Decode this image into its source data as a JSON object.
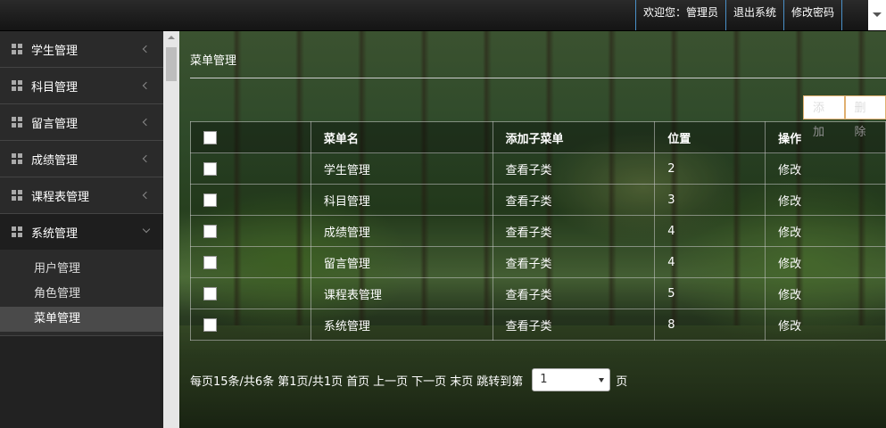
{
  "topbar": {
    "welcome": "欢迎您：管理员",
    "logout": "退出系统",
    "change_password": "修改密码"
  },
  "sidebar": {
    "items": [
      {
        "label": "学生管理",
        "icon": "grid-icon"
      },
      {
        "label": "科目管理",
        "icon": "grid-icon"
      },
      {
        "label": "留言管理",
        "icon": "grid-icon"
      },
      {
        "label": "成绩管理",
        "icon": "grid-icon"
      },
      {
        "label": "课程表管理",
        "icon": "grid-icon"
      },
      {
        "label": "系统管理",
        "icon": "grid-icon"
      }
    ],
    "submenu": [
      {
        "label": "用户管理"
      },
      {
        "label": "角色管理"
      },
      {
        "label": "菜单管理"
      }
    ]
  },
  "main": {
    "title": "菜单管理",
    "add_button": "添加",
    "delete_button": "删除",
    "table": {
      "headers": [
        "",
        "菜单名",
        "添加子菜单",
        "位置",
        "操作"
      ],
      "rows": [
        {
          "name": "学生管理",
          "sub": "查看子类",
          "position": "2",
          "action": "修改"
        },
        {
          "name": "科目管理",
          "sub": "查看子类",
          "position": "3",
          "action": "修改"
        },
        {
          "name": "成绩管理",
          "sub": "查看子类",
          "position": "4",
          "action": "修改"
        },
        {
          "name": "留言管理",
          "sub": "查看子类",
          "position": "4",
          "action": "修改"
        },
        {
          "name": "课程表管理",
          "sub": "查看子类",
          "position": "5",
          "action": "修改"
        },
        {
          "name": "系统管理",
          "sub": "查看子类",
          "position": "8",
          "action": "修改"
        }
      ]
    },
    "pager": {
      "summary": "每页15条/共6条",
      "page_info": "第1页/共1页",
      "first": "首页",
      "prev": "上一页",
      "next": "下一页",
      "last": "末页",
      "jump_prefix": "跳转到第",
      "jump_value": "1",
      "jump_suffix": "页"
    }
  }
}
